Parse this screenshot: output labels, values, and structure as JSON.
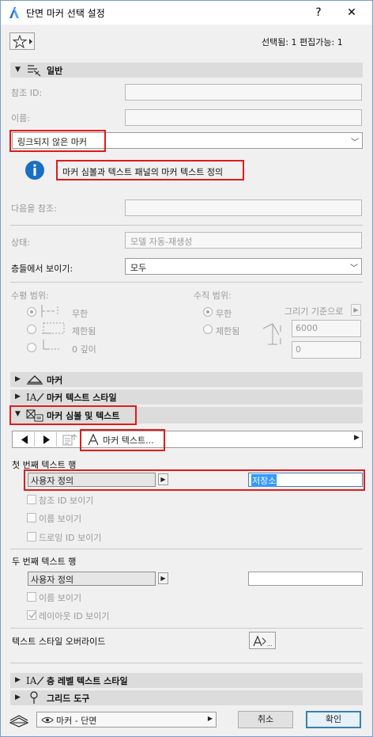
{
  "window": {
    "title": "단면 마커 선택 설정",
    "help": "?",
    "close": "✕"
  },
  "toolbar": {
    "selection_info": "선택됨: 1 편집가능: 1"
  },
  "sections": {
    "general": "일반",
    "marker": "마커",
    "marker_text_style": "마커 텍스트 스타일",
    "marker_symbol_text": "마커 심볼 및 텍스트",
    "story_level_text_style": "층 레벨 텍스트 스타일",
    "grid_tool": "그리드 도구"
  },
  "general": {
    "ref_id_label": "참조 ID:",
    "ref_id_value": "",
    "name_label": "이름:",
    "name_value": "",
    "marker_mode": "링크되지 않은 마커",
    "info_text": "마커 심볼과 텍스트 패널의 마커 텍스트 정의",
    "refer_to_label": "다음을 참조:",
    "refer_to_value": "",
    "status_label": "상태:",
    "status_value": "모델 자동-재생성",
    "show_on_stories_label": "층들에서 보이기:",
    "show_on_stories_value": "모두",
    "horizontal_range_label": "수평 범위:",
    "horizontal_options": [
      "무한",
      "제한됨",
      "0 깊이"
    ],
    "vertical_range_label": "수직 범위:",
    "vertical_options": [
      "무한",
      "제한됨"
    ],
    "draw_basis_label": "그리기 기준으로",
    "upper_value": "6000",
    "lower_value": "0"
  },
  "symbol_text": {
    "text_popup_label": "마커 텍스트...",
    "first_row_label": "첫 번째 텍스트 행",
    "first_row_mode": "사용자 정의",
    "first_row_value": "저장소",
    "show_ref_id": "참조 ID 보이기",
    "show_name": "이름 보이기",
    "show_drawing_id": "드로잉 ID 보이기",
    "second_row_label": "두 번째 텍스트 행",
    "second_row_mode": "사용자 정의",
    "second_row_value": "",
    "show_name_2": "이름 보이기",
    "show_layout_id": "레이아웃 ID 보이기",
    "override_label": "텍스트 스타일 오버라이드"
  },
  "footer": {
    "layer_value": "마커 - 단면",
    "cancel": "취소",
    "ok": "확인"
  },
  "colors": {
    "highlight_red": "#e21a1a",
    "info_blue": "#1a6fc4",
    "selection_blue": "#3399ff"
  }
}
